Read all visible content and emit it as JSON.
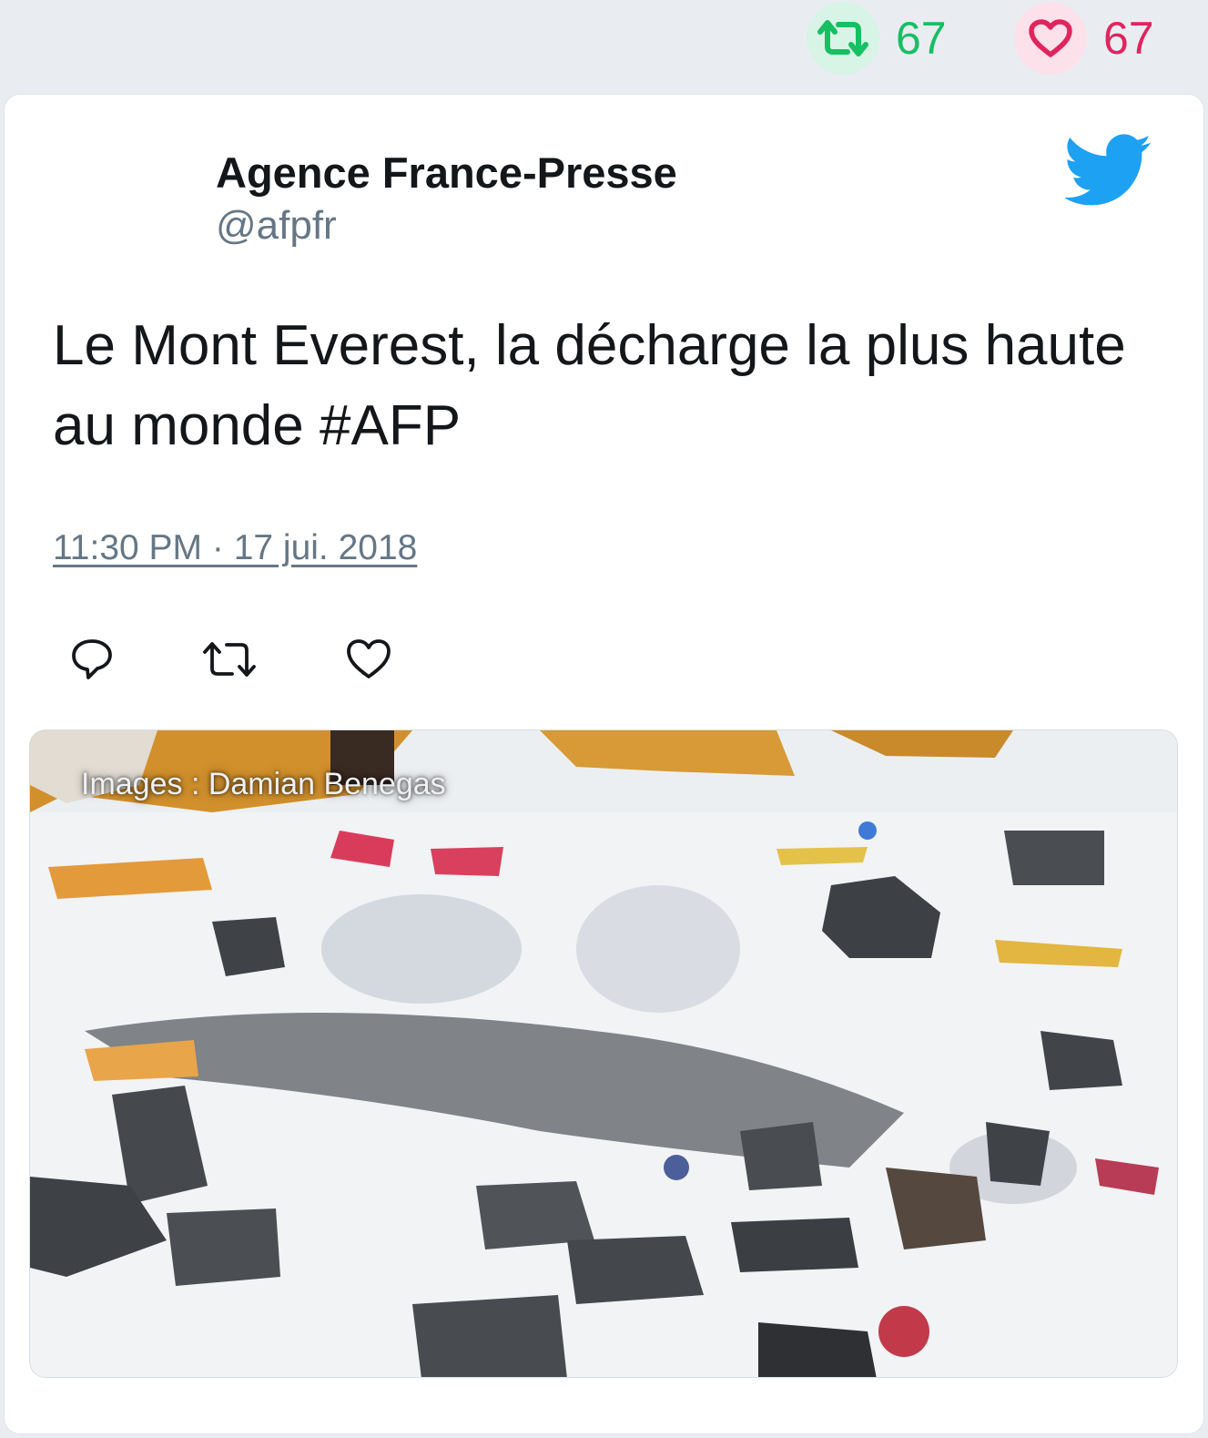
{
  "stats": {
    "retweets": "67",
    "likes": "67"
  },
  "tweet": {
    "author_name": "Agence France-Presse",
    "author_handle": "@afpfr",
    "text": "Le Mont Everest, la décharge la plus haute au monde #AFP",
    "timestamp": "11:30 PM · 17 jui. 2018"
  },
  "media": {
    "caption": "Images : Damian Benegas"
  },
  "icons": {
    "retweet": "retweet-icon",
    "like": "heart-icon",
    "reply": "reply-icon",
    "brand": "twitter-bird-icon"
  },
  "colors": {
    "retweet": "#17bf63",
    "like": "#e0245e",
    "brand": "#1da1f2",
    "muted": "#657786"
  }
}
